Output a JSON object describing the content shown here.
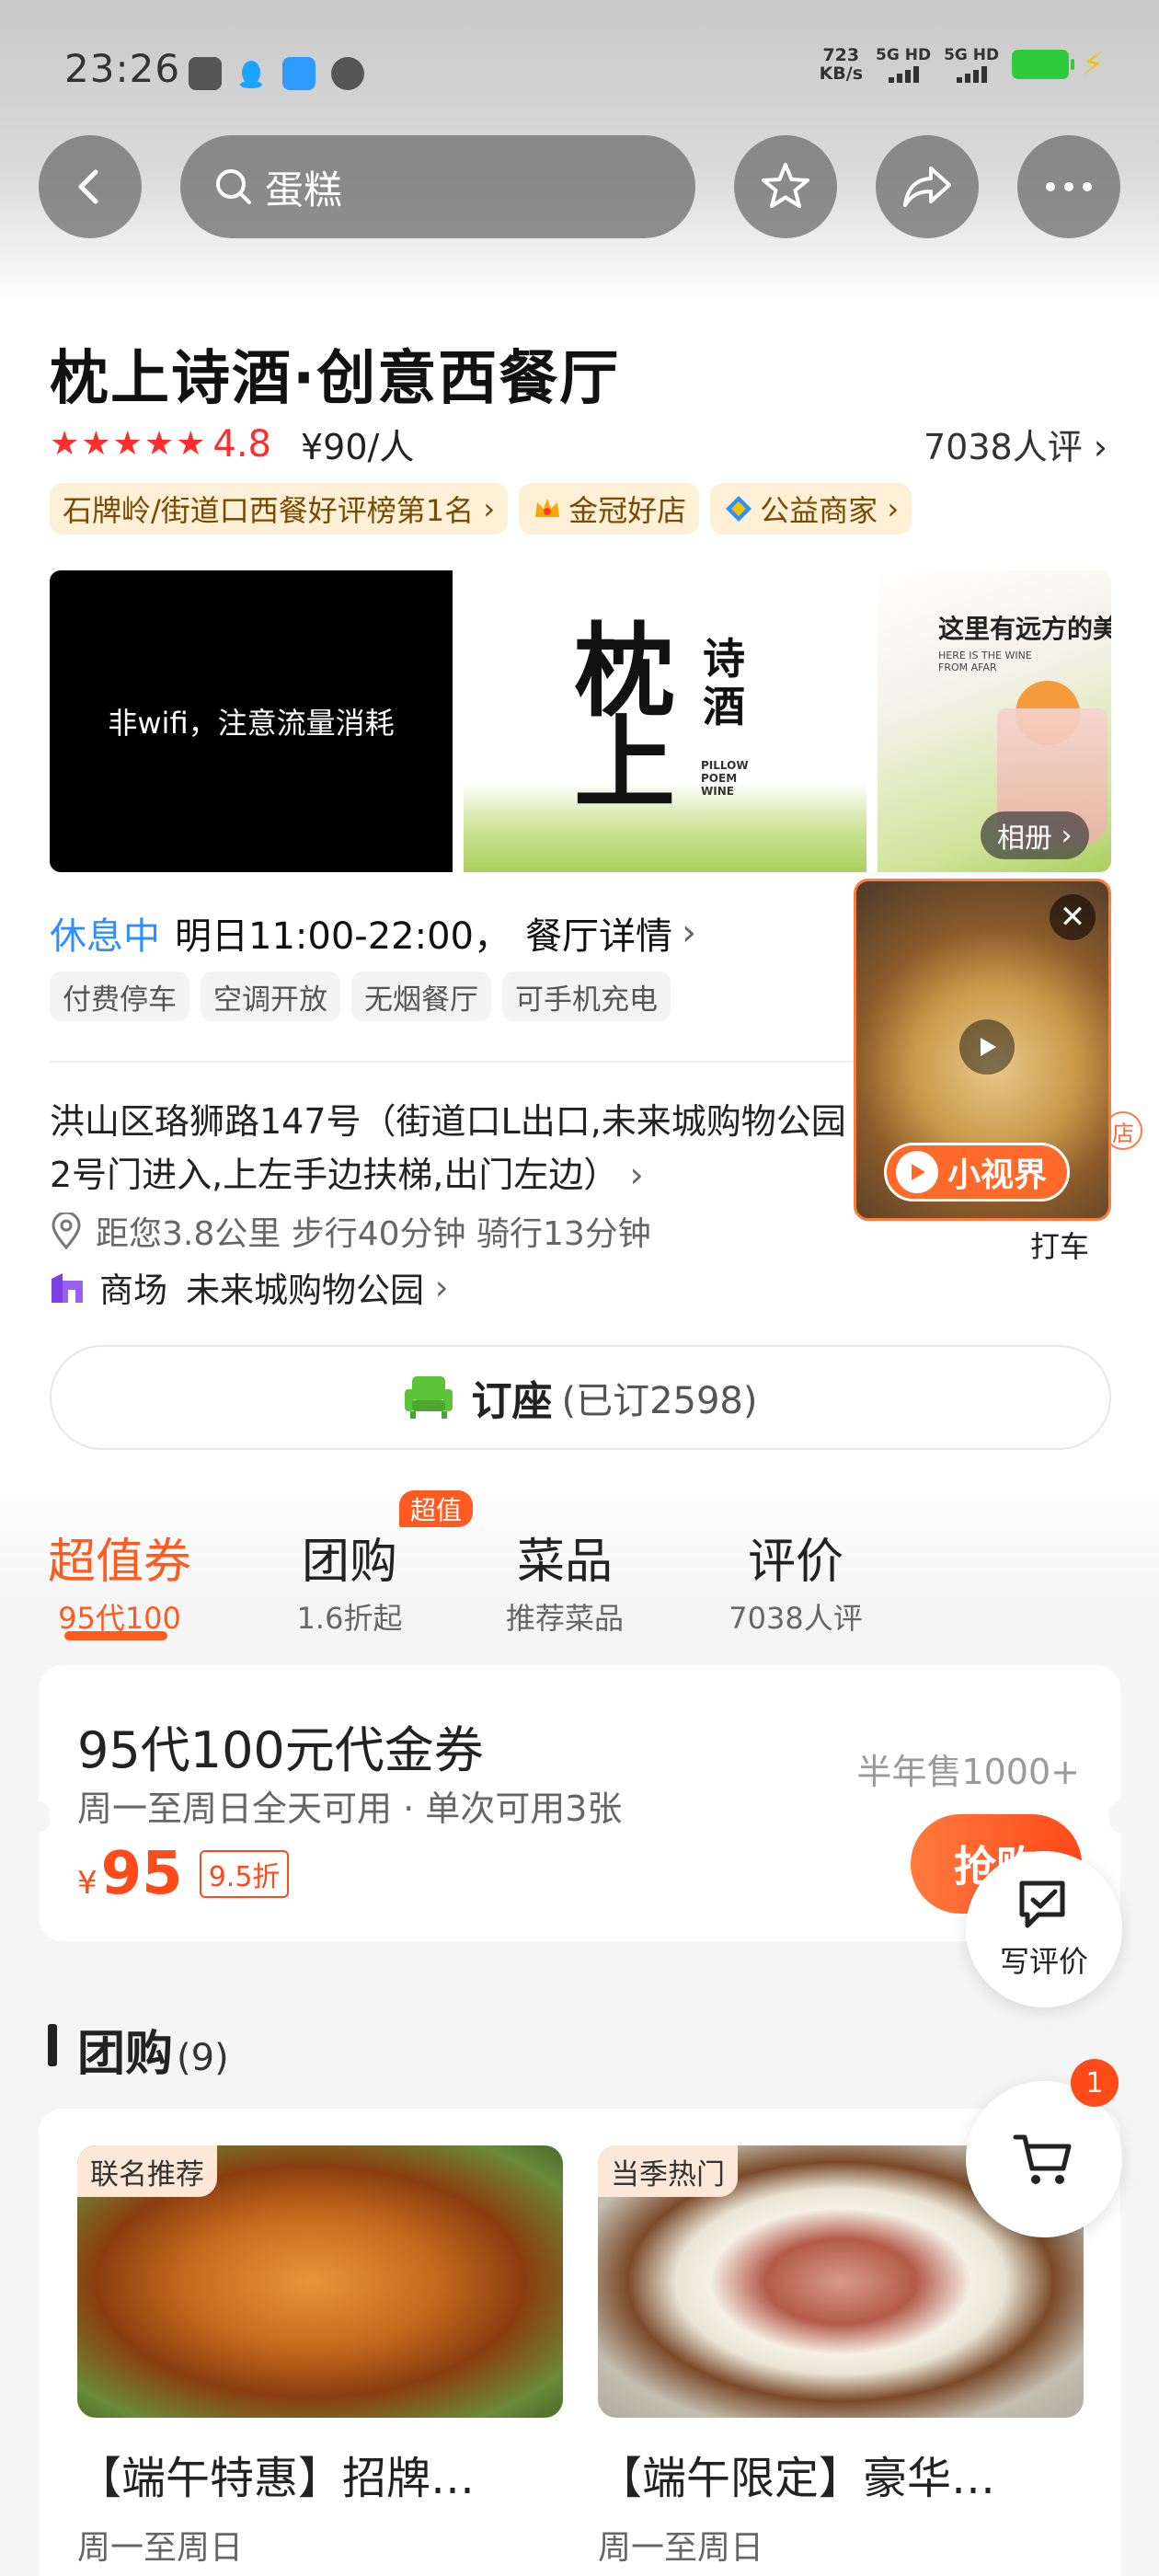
{
  "status_bar": {
    "time": "23:26",
    "net_speed_value": "723",
    "net_speed_unit": "KB/s",
    "signal_1": "5G HD",
    "signal_2": "5G HD"
  },
  "top_bar": {
    "search_text": "蛋糕"
  },
  "shop": {
    "title": "枕上诗酒·创意西餐厅",
    "stars": "★★★★★",
    "rating": "4.8",
    "avg_price": "¥90/人",
    "review_count": "7038人评"
  },
  "tags": [
    {
      "label": "石牌岭/街道口西餐好评榜第1名"
    },
    {
      "label": "金冠好店"
    },
    {
      "label": "公益商家"
    }
  ],
  "media": {
    "video_notice": "非wifi，注意流量消耗",
    "logo_big": "枕上",
    "logo_side": "诗酒",
    "logo_en": "PILLOW\nPOEM\nWINE",
    "drink_caption": "这里有远方的美",
    "drink_sub": "HERE IS THE WINE\nFROM AFAR",
    "album_label": "相册"
  },
  "hours": {
    "status": "休息中",
    "time": "明日11:00-22:00，",
    "detail_link": "餐厅详情"
  },
  "facilities": [
    "付费停车",
    "空调开放",
    "无烟餐厅",
    "可手机充电"
  ],
  "address": {
    "text": "洪山区珞狮路147号（街道口L出口,未来城购物公园2号门进入,上左手边扶梯,出门左边）",
    "distance": "距您3.8公里 步行40分钟 骑行13分钟",
    "mall_label": "商场",
    "mall_name": "未来城购物公园",
    "taxi": "打车",
    "shop_badge": "店"
  },
  "mini_video": {
    "brand": "小视界"
  },
  "booking": {
    "label": "订座",
    "count": "(已订2598)"
  },
  "tabs": [
    {
      "title": "超值券",
      "sub": "95代100",
      "active": true
    },
    {
      "title": "团购",
      "sub": "1.6折起",
      "badge": "超值"
    },
    {
      "title": "菜品",
      "sub": "推荐菜品"
    },
    {
      "title": "评价",
      "sub": "7038人评"
    }
  ],
  "voucher": {
    "title": "95代100元代金券",
    "desc": "周一至周日全天可用 · 单次可用3张",
    "currency": "¥",
    "price": "95",
    "discount": "9.5折",
    "sold": "半年售1000+",
    "buy_label": "抢购"
  },
  "fab": {
    "write_review": "写评价",
    "cart_badge": "1"
  },
  "group_buy": {
    "title": "团购",
    "count": "(9)",
    "items": [
      {
        "tag": "联名推荐",
        "name": "【端午特惠】招牌…",
        "avail": "周一至周日"
      },
      {
        "tag": "当季热门",
        "name": "【端午限定】豪华…",
        "avail": "周一至周日"
      }
    ]
  },
  "colors": {
    "accent": "#ff5a1f",
    "rating_red": "#ff2d2d",
    "resting_blue": "#2f8fff",
    "tag_bg": "#fdf0d6"
  }
}
